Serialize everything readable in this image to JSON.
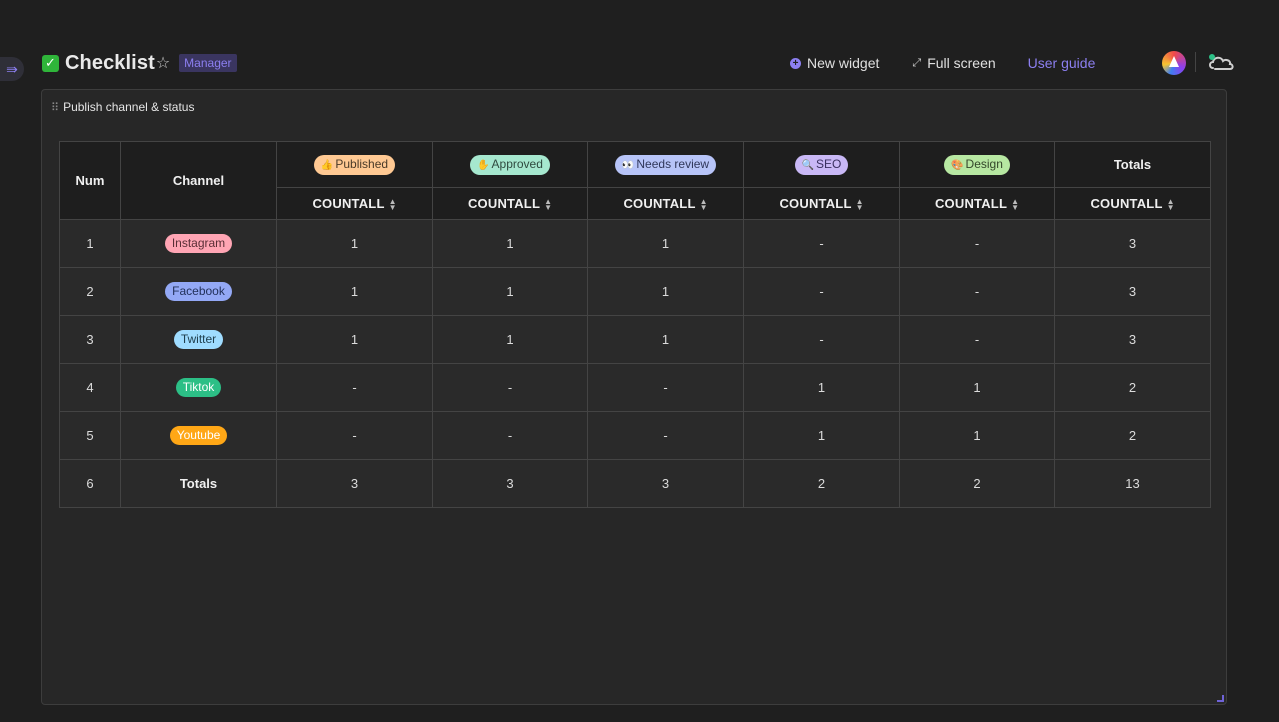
{
  "header": {
    "title": "Checklist",
    "role_badge": "Manager",
    "actions": {
      "new_widget": "New widget",
      "full_screen": "Full screen",
      "user_guide": "User guide"
    }
  },
  "widget": {
    "title": "Publish channel & status",
    "table": {
      "row_headers": [
        "Num",
        "Channel"
      ],
      "status_columns": [
        {
          "label": "Published",
          "emoji": "👍",
          "bg": "#ffc993",
          "fg": "#4a3a28"
        },
        {
          "label": "Approved",
          "emoji": "✋",
          "bg": "#a6e8cf",
          "fg": "#2f4a3f"
        },
        {
          "label": "Needs review",
          "emoji": "👀",
          "bg": "#b7c4f8",
          "fg": "#30375a"
        },
        {
          "label": "SEO",
          "emoji": "🔍",
          "bg": "#c9b8f6",
          "fg": "#3a3060"
        },
        {
          "label": "Design",
          "emoji": "🎨",
          "bg": "#b7e8a2",
          "fg": "#34472b"
        }
      ],
      "totals_label": "Totals",
      "measure_label": "COUNTALL",
      "rows": [
        {
          "num": "1",
          "channel": "Instagram",
          "bg": "#ffa5b4",
          "fg": "#5a2e36",
          "values": [
            "1",
            "1",
            "1",
            "-",
            "-"
          ],
          "total": "3"
        },
        {
          "num": "2",
          "channel": "Facebook",
          "bg": "#93a8f5",
          "fg": "#22305a",
          "values": [
            "1",
            "1",
            "1",
            "-",
            "-"
          ],
          "total": "3"
        },
        {
          "num": "3",
          "channel": "Twitter",
          "bg": "#9fdcff",
          "fg": "#20404f",
          "values": [
            "1",
            "1",
            "1",
            "-",
            "-"
          ],
          "total": "3"
        },
        {
          "num": "4",
          "channel": "Tiktok",
          "bg": "#2cbf86",
          "fg": "#ffffff",
          "values": [
            "-",
            "-",
            "-",
            "1",
            "1"
          ],
          "total": "2"
        },
        {
          "num": "5",
          "channel": "Youtube",
          "bg": "#ffa716",
          "fg": "#ffffff",
          "values": [
            "-",
            "-",
            "-",
            "1",
            "1"
          ],
          "total": "2"
        }
      ],
      "totals_row": {
        "num": "6",
        "label": "Totals",
        "values": [
          "3",
          "3",
          "3",
          "2",
          "2"
        ],
        "total": "13"
      }
    }
  },
  "colors": {
    "accent": "#8c7ff0",
    "background": "#1f1f1f",
    "panel": "#272727"
  }
}
